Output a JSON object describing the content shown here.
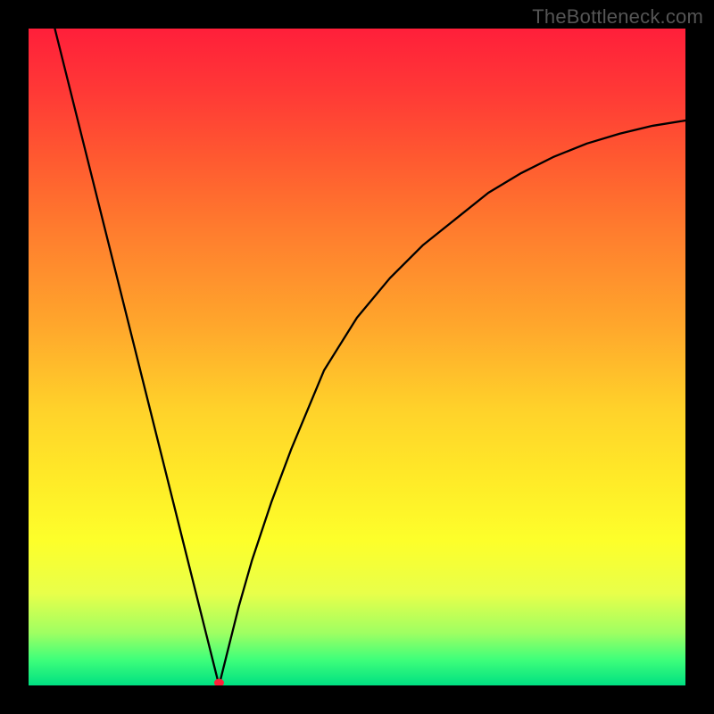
{
  "watermark": "TheBottleneck.com",
  "chart_data": {
    "type": "line",
    "title": "",
    "xlabel": "",
    "ylabel": "",
    "xlim": [
      0,
      100
    ],
    "ylim": [
      0,
      100
    ],
    "grid": false,
    "legend": false,
    "notch_x_percent": 29,
    "marker": {
      "x_percent": 29,
      "y_percent": 0,
      "color": "#ff1f3a"
    },
    "background_gradient_stops": [
      {
        "pct": 0,
        "hex": "#ff1f3a"
      },
      {
        "pct": 10,
        "hex": "#ff3a36"
      },
      {
        "pct": 20,
        "hex": "#ff5a30"
      },
      {
        "pct": 30,
        "hex": "#ff7a2e"
      },
      {
        "pct": 45,
        "hex": "#ffa62c"
      },
      {
        "pct": 58,
        "hex": "#ffd22a"
      },
      {
        "pct": 68,
        "hex": "#ffe928"
      },
      {
        "pct": 78,
        "hex": "#fdff2a"
      },
      {
        "pct": 86,
        "hex": "#e8ff4a"
      },
      {
        "pct": 92,
        "hex": "#9fff62"
      },
      {
        "pct": 96,
        "hex": "#40ff7a"
      },
      {
        "pct": 100,
        "hex": "#00e082"
      }
    ],
    "series": [
      {
        "name": "curve",
        "x": [
          4,
          6,
          8,
          10,
          12,
          14,
          16,
          18,
          20,
          22,
          24,
          26,
          27,
          28,
          29,
          30,
          31,
          32,
          34,
          37,
          40,
          45,
          50,
          55,
          60,
          65,
          70,
          75,
          80,
          85,
          90,
          95,
          100
        ],
        "values": [
          100,
          92,
          84,
          76,
          68,
          60,
          52,
          44,
          36,
          28,
          20,
          12,
          8,
          4,
          0,
          4,
          8,
          12,
          19,
          28,
          36,
          48,
          56,
          62,
          67,
          71,
          75,
          78,
          80.5,
          82.5,
          84,
          85.2,
          86
        ]
      }
    ]
  }
}
